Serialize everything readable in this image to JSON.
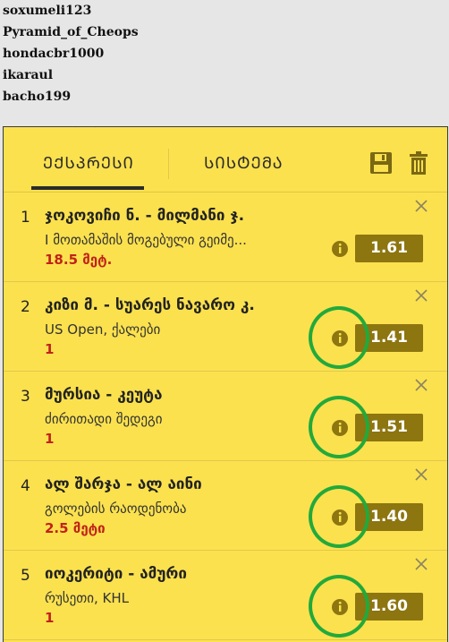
{
  "usernames": [
    "soxumeli123",
    "Pyramid_of_Cheops",
    "hondacbr1000",
    "ikaraul",
    "bacho199"
  ],
  "tabs": {
    "express": "ᲔᲥᲡᲞᲠᲔᲡᲘ",
    "system": "ᲡᲘᲡᲢᲔᲛᲐ"
  },
  "icons": {
    "save": "save-icon",
    "trash": "trash-icon",
    "close": "close-icon",
    "info": "info-icon"
  },
  "colors": {
    "panel": "#fbe14e",
    "odds_bg": "#8d7510",
    "highlight": "#23a93b",
    "pick_text": "#c0221a"
  },
  "bets": [
    {
      "num": "1",
      "teams": "ჯოკოვიჩი ნ. - მილმანი ჯ.",
      "market": "I მოთამაშის მოგებული გეიმე...",
      "pick": "18.5 მეტ.",
      "odds": "1.61",
      "highlighted": false
    },
    {
      "num": "2",
      "teams": "კიზი მ. - სუარეს ნავარო კ.",
      "market": "US Open, ქალები",
      "pick": "1",
      "odds": "1.41",
      "highlighted": true
    },
    {
      "num": "3",
      "teams": "მურსია - კეუტა",
      "market": "ძირითადი შედეგი",
      "pick": "1",
      "odds": "1.51",
      "highlighted": true
    },
    {
      "num": "4",
      "teams": "ალ შარჯა - ალ აინი",
      "market": "გოლების რაოდენობა",
      "pick": "2.5 მეტი",
      "odds": "1.40",
      "highlighted": true
    },
    {
      "num": "5",
      "teams": "იოკერიტი - ამური",
      "market": "რუსეთი, KHL",
      "pick": "1",
      "odds": "1.60",
      "highlighted": true
    }
  ]
}
